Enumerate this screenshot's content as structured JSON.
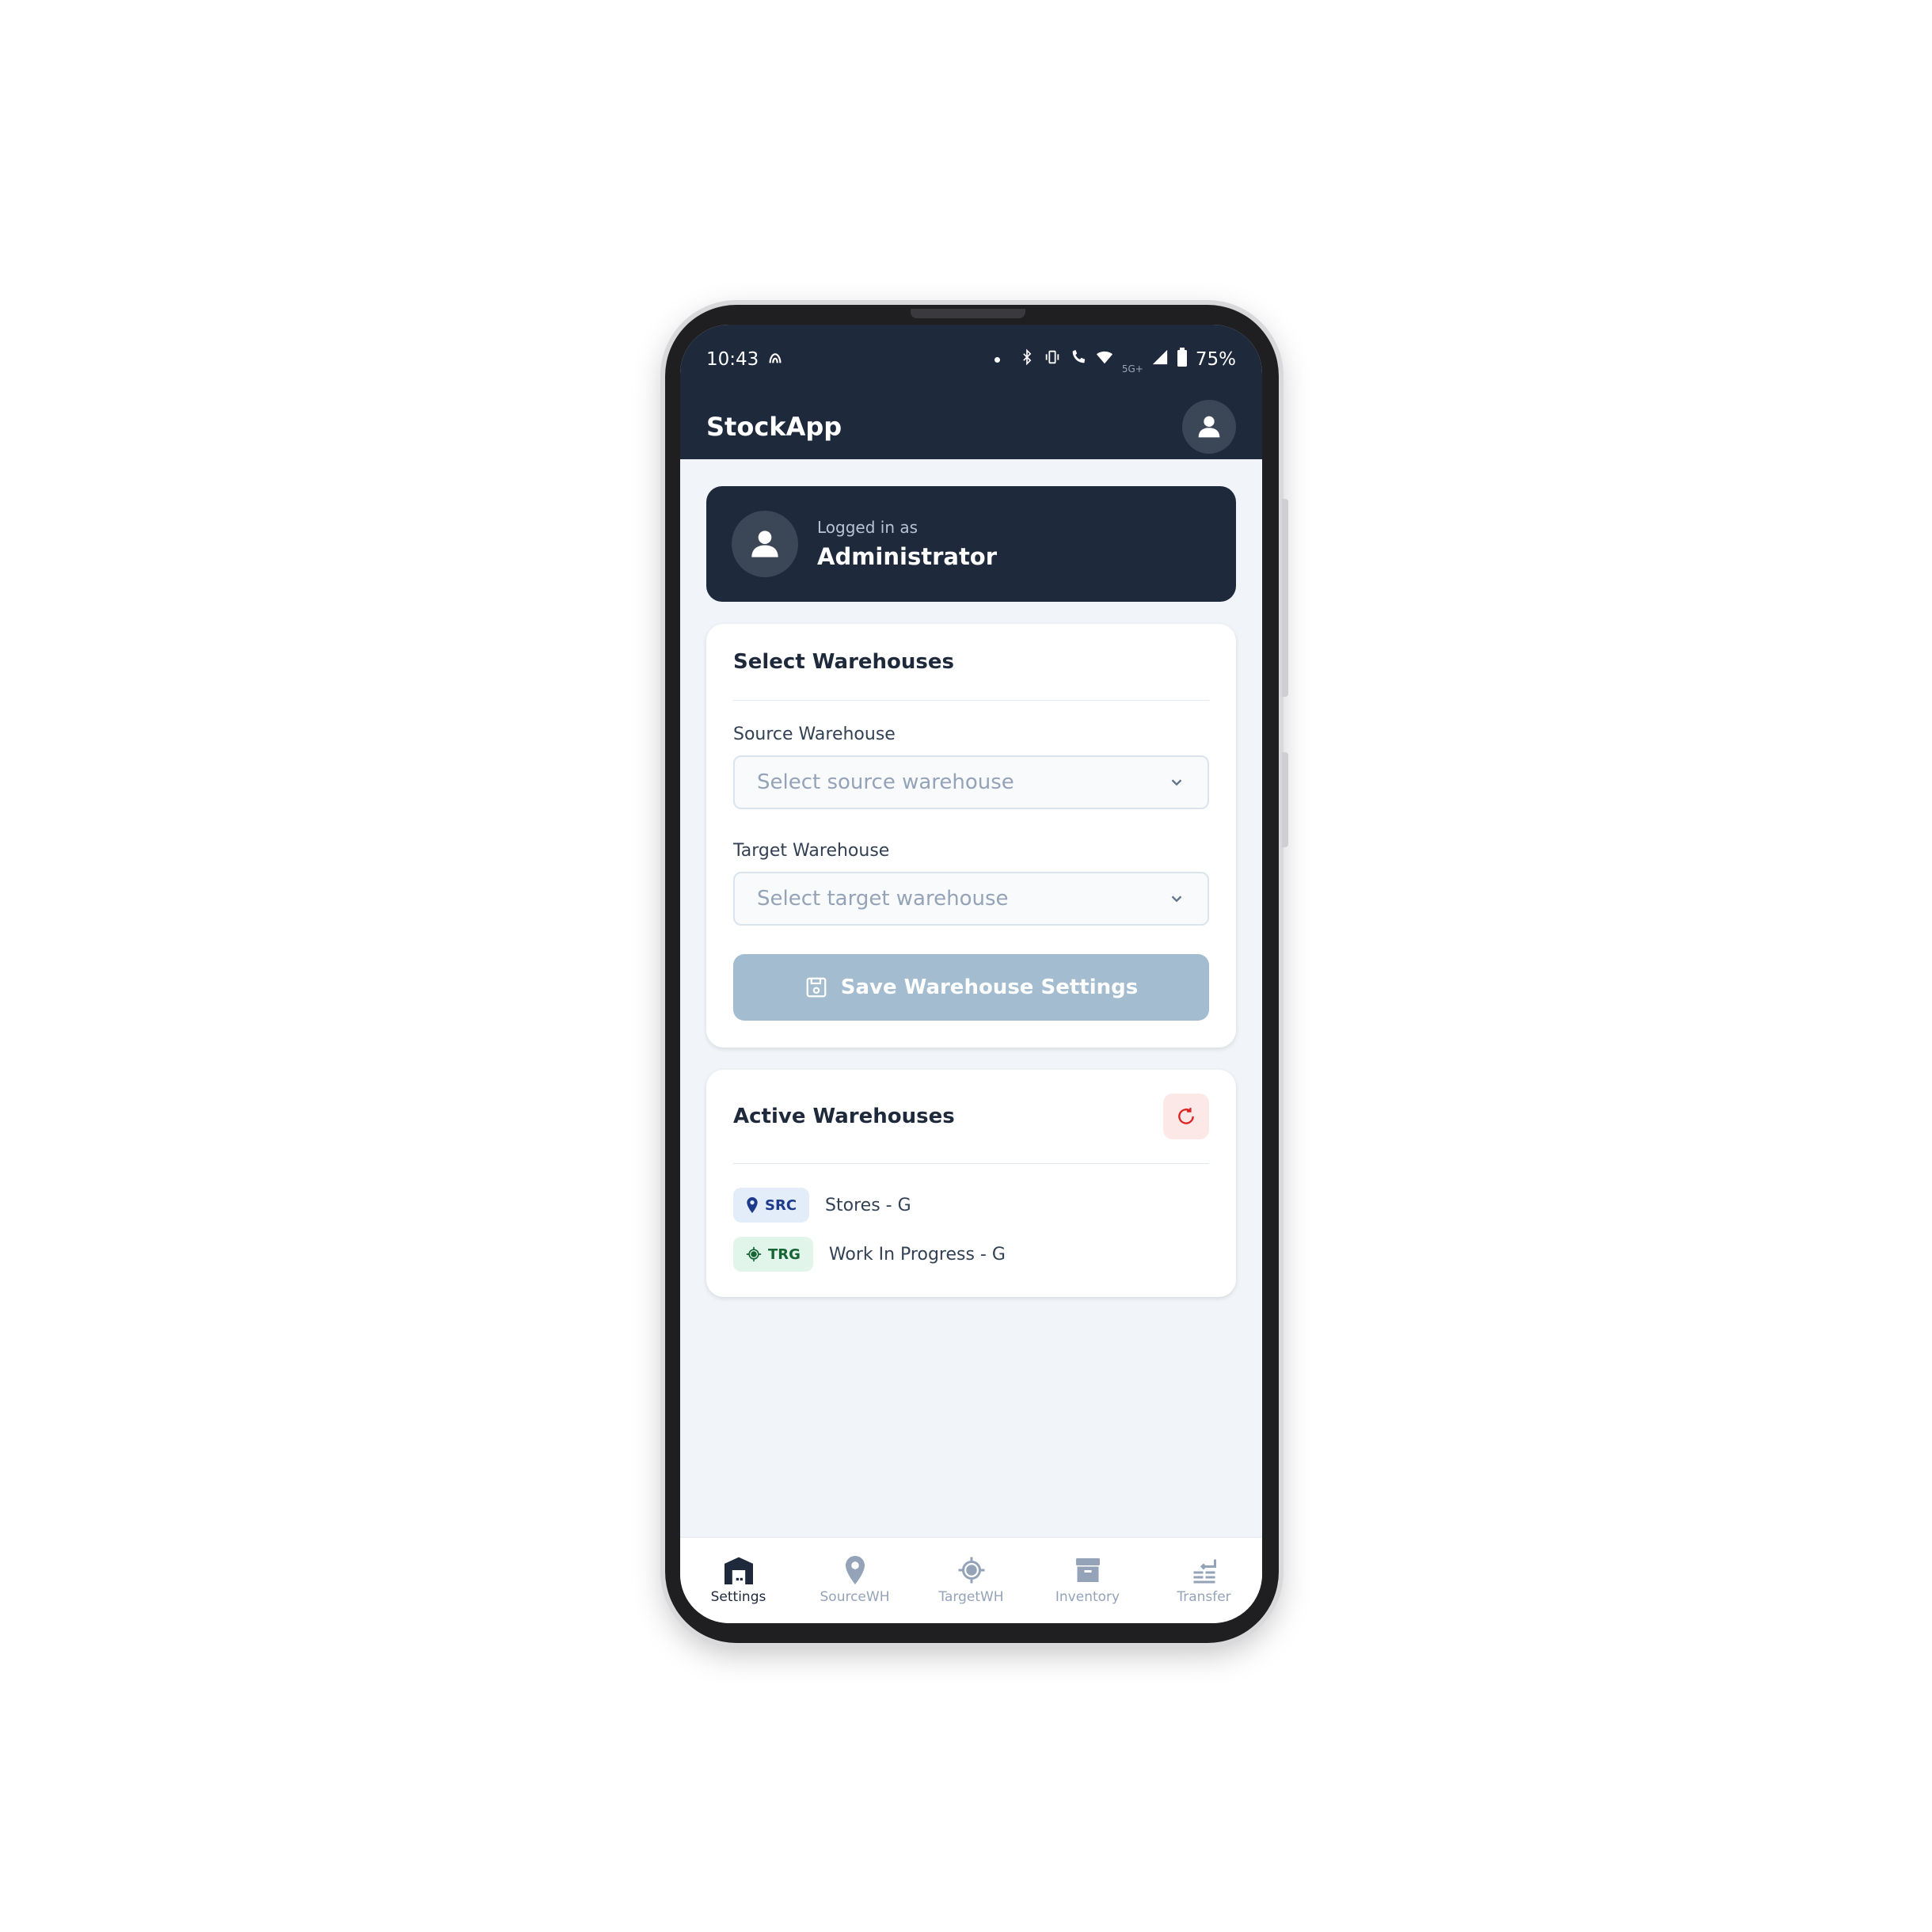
{
  "status_bar": {
    "time": "10:43",
    "network": "5G+",
    "battery": "75%"
  },
  "app": {
    "title": "StockApp"
  },
  "user": {
    "logged_in_label": "Logged in as",
    "name": "Administrator"
  },
  "select_warehouses": {
    "title": "Select Warehouses",
    "source_label": "Source Warehouse",
    "source_placeholder": "Select source warehouse",
    "target_label": "Target Warehouse",
    "target_placeholder": "Select target warehouse",
    "save_label": "Save Warehouse Settings"
  },
  "active_warehouses": {
    "title": "Active Warehouses",
    "items": [
      {
        "badge": "SRC",
        "name": "Stores - G"
      },
      {
        "badge": "TRG",
        "name": "Work In Progress - G"
      }
    ]
  },
  "bottom_nav": {
    "items": [
      {
        "label": "Settings",
        "icon": "warehouse-icon"
      },
      {
        "label": "SourceWH",
        "icon": "map-pin-icon"
      },
      {
        "label": "TargetWH",
        "icon": "crosshair-icon"
      },
      {
        "label": "Inventory",
        "icon": "archive-box-icon"
      },
      {
        "label": "Transfer",
        "icon": "transfer-icon"
      }
    ],
    "active_index": 0
  },
  "colors": {
    "primary_dark": "#1e293b",
    "disabled_button": "#a3bccf",
    "refresh_accent": "#dc2626",
    "src_badge": "#1e3a8a",
    "trg_badge": "#166534"
  }
}
